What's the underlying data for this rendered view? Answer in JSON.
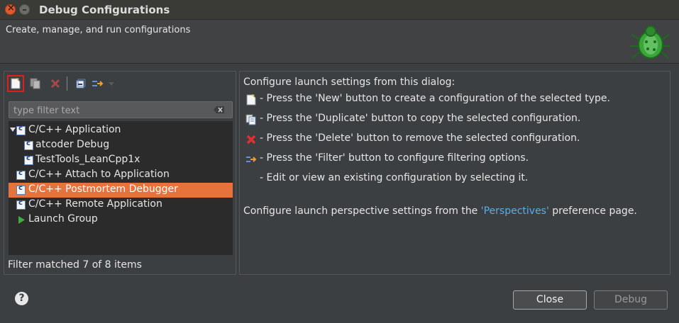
{
  "window": {
    "title": "Debug Configurations"
  },
  "banner": {
    "subtitle": "Create, manage, and run configurations"
  },
  "toolbar": {
    "buttons": [
      "new-configuration",
      "duplicate",
      "delete",
      "collapse-all",
      "filter"
    ]
  },
  "filter": {
    "placeholder": "type filter text",
    "value": ""
  },
  "tree": {
    "items": [
      {
        "label": "C/C++ Application",
        "level": 0,
        "expanded": true,
        "icon": "c-app-icon"
      },
      {
        "label": "atcoder Debug",
        "level": 1,
        "icon": "c-config-icon"
      },
      {
        "label": "TestTools_LeanCpp1x",
        "level": 1,
        "icon": "c-config-icon"
      },
      {
        "label": "C/C++ Attach to Application",
        "level": 0,
        "icon": "c-app-icon"
      },
      {
        "label": "C/C++ Postmortem Debugger",
        "level": 0,
        "icon": "c-app-icon",
        "selected": true
      },
      {
        "label": "C/C++ Remote Application",
        "level": 0,
        "icon": "c-app-icon"
      },
      {
        "label": "Launch Group",
        "level": 0,
        "icon": "launch-group-icon"
      }
    ]
  },
  "status": {
    "filter_matched": "Filter matched 7 of 8 items"
  },
  "info": {
    "intro": "Configure launch settings from this dialog:",
    "hints": [
      {
        "icon": "new-icon",
        "text": "- Press the 'New' button to create a configuration of the selected type."
      },
      {
        "icon": "duplicate-icon",
        "text": "- Press the 'Duplicate' button to copy the selected configuration."
      },
      {
        "icon": "delete-icon",
        "text": "- Press the 'Delete' button to remove the selected configuration."
      },
      {
        "icon": "filter-icon",
        "text": "- Press the 'Filter' button to configure filtering options."
      },
      {
        "icon": "",
        "text": "- Edit or view an existing configuration by selecting it."
      }
    ],
    "perspective_prefix": "Configure launch perspective settings from the ",
    "perspective_link": "'Perspectives'",
    "perspective_suffix": " preference page."
  },
  "buttons": {
    "close": "Close",
    "debug": "Debug"
  },
  "colors": {
    "selection": "#e6733c",
    "link": "#5aaee8",
    "accent_red": "#e02020"
  }
}
